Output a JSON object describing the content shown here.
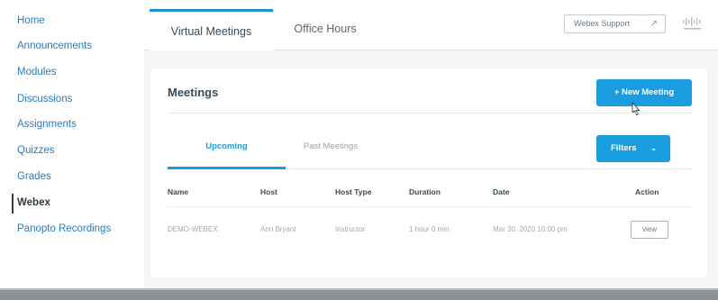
{
  "sidebar": {
    "items": [
      {
        "label": "Home"
      },
      {
        "label": "Announcements"
      },
      {
        "label": "Modules"
      },
      {
        "label": "Discussions"
      },
      {
        "label": "Assignments"
      },
      {
        "label": "Quizzes"
      },
      {
        "label": "Grades"
      },
      {
        "label": "Webex"
      },
      {
        "label": "Panopto Recordings"
      }
    ],
    "active_index": 7
  },
  "tabs": [
    {
      "label": "Virtual Meetings",
      "active": true
    },
    {
      "label": "Office Hours",
      "active": false
    }
  ],
  "header": {
    "support_label": "Webex Support",
    "support_icon": "external-link-icon",
    "logo": "cisco-logo"
  },
  "meetings": {
    "title": "Meetings",
    "new_button_label": "+ New Meeting",
    "subtabs": [
      {
        "label": "Upcoming",
        "active": true
      },
      {
        "label": "Past Meetings",
        "active": false
      }
    ],
    "filters_label": "Filters",
    "columns": [
      "Name",
      "Host",
      "Host Type",
      "Duration",
      "Date",
      "Action"
    ],
    "rows": [
      {
        "name": "DEMO-WEBEX",
        "host": "Ann Bryant",
        "host_type": "Instructor",
        "duration": "1 hour 0 min",
        "date": "Mar 30, 2020 10:00 pm",
        "action": "view"
      }
    ]
  },
  "colors": {
    "accent": "#1a9ce1",
    "link": "#2b7abc",
    "text_dark": "#2d3b45",
    "content_bg": "#f5f5f5"
  }
}
